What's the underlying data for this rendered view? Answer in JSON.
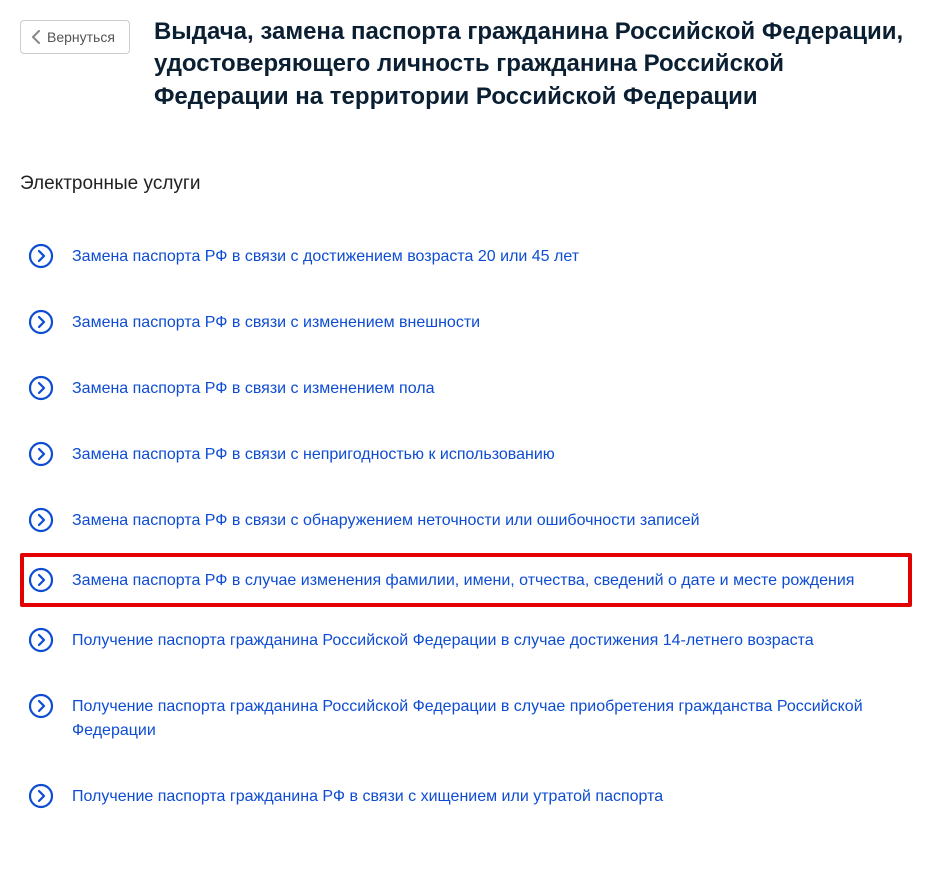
{
  "back": {
    "label": "Вернуться"
  },
  "title": "Выдача, замена паспорта гражданина Российской Федерации, удостоверяющего личность гражданина Российской Федерации на территории Российской Федерации",
  "section_heading": "Электронные услуги",
  "services": [
    {
      "label": "Замена паспорта РФ в связи с достижением возраста 20 или 45 лет",
      "highlighted": false
    },
    {
      "label": "Замена паспорта РФ в связи с изменением внешности",
      "highlighted": false
    },
    {
      "label": "Замена паспорта РФ в связи с изменением пола",
      "highlighted": false
    },
    {
      "label": "Замена паспорта РФ в связи с непригодностью к использованию",
      "highlighted": false
    },
    {
      "label": "Замена паспорта РФ в связи с обнаружением неточности или ошибочности записей",
      "highlighted": false
    },
    {
      "label": "Замена паспорта РФ в случае изменения фамилии, имени, отчества, сведений о дате и месте рождения",
      "highlighted": true
    },
    {
      "label": "Получение паспорта гражданина Российской Федерации в случае достижения 14-летнего возраста",
      "highlighted": false
    },
    {
      "label": "Получение паспорта гражданина Российской Федерации в случае приобретения гражданства Российской Федерации",
      "highlighted": false
    },
    {
      "label": "Получение паспорта гражданина РФ в связи с хищением или утратой паспорта",
      "highlighted": false
    }
  ]
}
